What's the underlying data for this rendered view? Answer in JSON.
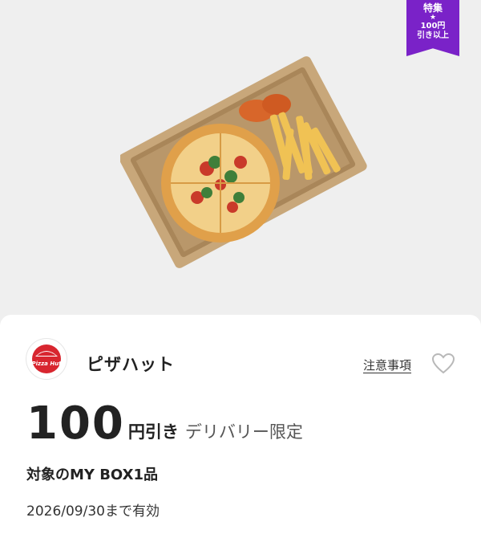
{
  "badge": {
    "title": "特集",
    "star": "★",
    "line1": "100円",
    "line2": "引き以上"
  },
  "coupon": {
    "brand_name": "ピザハット",
    "brand_logo_text": "Pizza Hut",
    "notes_link": "注意事項",
    "amount": "100",
    "unit": "円引き",
    "limit": "デリバリー限定",
    "target": "対象のMY BOX1品",
    "validity": "2026/09/30まで有効"
  },
  "colors": {
    "badge": "#7a22c8",
    "brand_red": "#d8262f",
    "background": "#efefef",
    "card": "#ffffff"
  },
  "icons": {
    "favorite": "heart-outline-icon"
  }
}
